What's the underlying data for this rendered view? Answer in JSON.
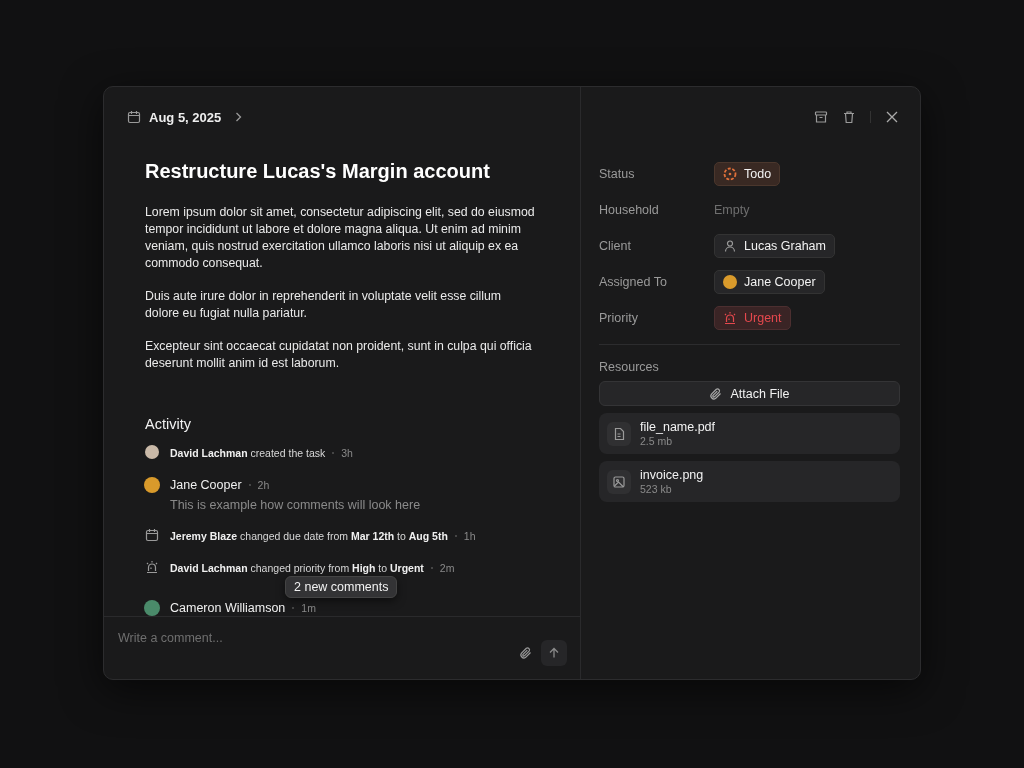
{
  "header": {
    "date": "Aug 5, 2025"
  },
  "task": {
    "title": "Restructure Lucas's Margin account",
    "paragraphs": [
      "Lorem ipsum dolor sit amet, consectetur adipiscing elit, sed do eiusmod tempor incididunt ut labore et dolore magna aliqua. Ut enim ad minim veniam, quis nostrud exercitation ullamco laboris nisi ut aliquip ex ea commodo consequat.",
      "Duis aute irure dolor in reprehenderit in voluptate velit esse cillum dolore eu fugiat nulla pariatur.",
      "Excepteur sint occaecat cupidatat non proident, sunt in culpa qui officia deserunt mollit anim id est laborum."
    ]
  },
  "activity": {
    "title": "Activity",
    "items": [
      {
        "kind": "created",
        "color": "#c9b9a8",
        "text": "**David Lachman** created the task",
        "time": "3h"
      },
      {
        "kind": "comment",
        "color": "#d99a2b",
        "author": "Jane Cooper",
        "time": "2h",
        "text": "This is example how comments will look here"
      },
      {
        "kind": "date_change",
        "text": "**Jeremy Blaze** changed due date from **Mar 12th** to **Aug 5th**",
        "time": "1h"
      },
      {
        "kind": "priority_change",
        "text": "**David Lachman** changed priority from **High** to **Urgent**",
        "time": "2m"
      },
      {
        "kind": "comment",
        "color": "#4a8a6a",
        "author": "Cameron Williamson",
        "time": "1m"
      }
    ],
    "new_comments": "2 new comments"
  },
  "comment_box": {
    "placeholder": "Write a comment..."
  },
  "properties": [
    {
      "label": "Status",
      "kind": "status",
      "value": "Todo",
      "color": "#e0703a"
    },
    {
      "label": "Household",
      "kind": "empty",
      "value": "Empty"
    },
    {
      "label": "Client",
      "kind": "person",
      "value": "Lucas Graham"
    },
    {
      "label": "Assigned To",
      "kind": "avatar",
      "value": "Jane Cooper",
      "color": "#d99a2b"
    },
    {
      "label": "Priority",
      "kind": "priority",
      "value": "Urgent",
      "color": "#e5484d"
    }
  ],
  "resources": {
    "title": "Resources",
    "attach_button": "Attach File",
    "files": [
      {
        "kind": "document",
        "name": "file_name.pdf",
        "size": "2.5 mb"
      },
      {
        "kind": "image",
        "name": "invoice.png",
        "size": "523 kb"
      }
    ]
  }
}
